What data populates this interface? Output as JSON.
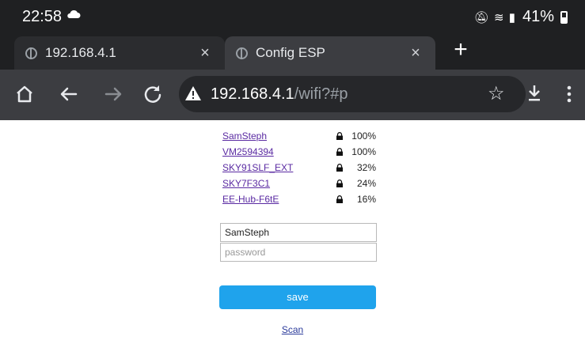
{
  "status_bar": {
    "time": "22:58",
    "battery_percent": "41%",
    "icons": [
      "cloud-icon",
      "mute-icon",
      "wifi-icon",
      "signal-icon",
      "battery-icon"
    ]
  },
  "tabs": [
    {
      "title": "192.168.4.1",
      "close": "×",
      "active": false
    },
    {
      "title": "Config ESP",
      "close": "×",
      "active": true
    }
  ],
  "new_tab_label": "+",
  "toolbar": {
    "url_host": "192.168.4.1",
    "url_path": "/wifi?#p",
    "security": "not-secure-warning"
  },
  "networks": [
    {
      "ssid": "SamSteph",
      "signal": "100%"
    },
    {
      "ssid": "VM2594394",
      "signal": "100%"
    },
    {
      "ssid": "SKY91SLF_EXT",
      "signal": "32%"
    },
    {
      "ssid": "SKY7F3C1",
      "signal": "24%"
    },
    {
      "ssid": "EE-Hub-F6tE",
      "signal": "16%"
    }
  ],
  "form": {
    "ssid_value": "SamSteph",
    "password_placeholder": "password",
    "save_label": "save",
    "scan_label": "Scan"
  },
  "colors": {
    "chrome_dark": "#1f2022",
    "toolbar": "#3c3d41",
    "save_button": "#1fa3ec",
    "link": "#5a2aa2"
  }
}
